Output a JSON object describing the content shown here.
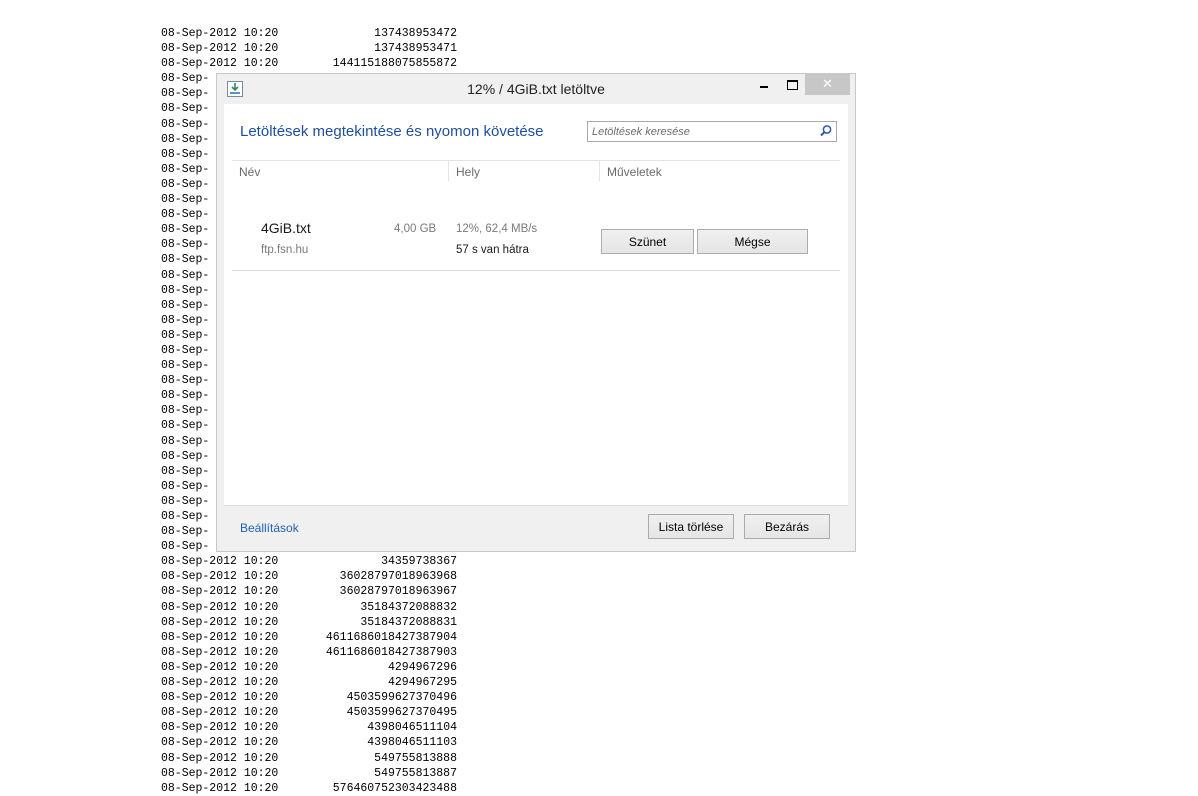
{
  "listing": {
    "rows": [
      {
        "date": "08-Sep-2012 10:20",
        "size": "137438953472"
      },
      {
        "date": "08-Sep-2012 10:20",
        "size": "137438953471"
      },
      {
        "date": "08-Sep-2012 10:20",
        "size": "144115188075855872"
      },
      {
        "date": "08-Sep-",
        "size": ""
      },
      {
        "date": "08-Sep-",
        "size": ""
      },
      {
        "date": "08-Sep-",
        "size": ""
      },
      {
        "date": "08-Sep-",
        "size": ""
      },
      {
        "date": "08-Sep-",
        "size": ""
      },
      {
        "date": "08-Sep-",
        "size": ""
      },
      {
        "date": "08-Sep-",
        "size": ""
      },
      {
        "date": "08-Sep-",
        "size": ""
      },
      {
        "date": "08-Sep-",
        "size": ""
      },
      {
        "date": "08-Sep-",
        "size": ""
      },
      {
        "date": "08-Sep-",
        "size": ""
      },
      {
        "date": "08-Sep-",
        "size": ""
      },
      {
        "date": "08-Sep-",
        "size": ""
      },
      {
        "date": "08-Sep-",
        "size": ""
      },
      {
        "date": "08-Sep-",
        "size": ""
      },
      {
        "date": "08-Sep-",
        "size": ""
      },
      {
        "date": "08-Sep-",
        "size": ""
      },
      {
        "date": "08-Sep-",
        "size": ""
      },
      {
        "date": "08-Sep-",
        "size": ""
      },
      {
        "date": "08-Sep-",
        "size": ""
      },
      {
        "date": "08-Sep-",
        "size": ""
      },
      {
        "date": "08-Sep-",
        "size": ""
      },
      {
        "date": "08-Sep-",
        "size": ""
      },
      {
        "date": "08-Sep-",
        "size": ""
      },
      {
        "date": "08-Sep-",
        "size": ""
      },
      {
        "date": "08-Sep-",
        "size": ""
      },
      {
        "date": "08-Sep-",
        "size": ""
      },
      {
        "date": "08-Sep-",
        "size": ""
      },
      {
        "date": "08-Sep-",
        "size": ""
      },
      {
        "date": "08-Sep-",
        "size": ""
      },
      {
        "date": "08-Sep-",
        "size": ""
      },
      {
        "date": "08-Sep-",
        "size": ""
      },
      {
        "date": "08-Sep-2012 10:20",
        "size": "34359738367"
      },
      {
        "date": "08-Sep-2012 10:20",
        "size": "36028797018963968"
      },
      {
        "date": "08-Sep-2012 10:20",
        "size": "36028797018963967"
      },
      {
        "date": "08-Sep-2012 10:20",
        "size": "35184372088832"
      },
      {
        "date": "08-Sep-2012 10:20",
        "size": "35184372088831"
      },
      {
        "date": "08-Sep-2012 10:20",
        "size": "4611686018427387904"
      },
      {
        "date": "08-Sep-2012 10:20",
        "size": "4611686018427387903"
      },
      {
        "date": "08-Sep-2012 10:20",
        "size": "4294967296"
      },
      {
        "date": "08-Sep-2012 10:20",
        "size": "4294967295"
      },
      {
        "date": "08-Sep-2012 10:20",
        "size": "4503599627370496"
      },
      {
        "date": "08-Sep-2012 10:20",
        "size": "4503599627370495"
      },
      {
        "date": "08-Sep-2012 10:20",
        "size": "4398046511104"
      },
      {
        "date": "08-Sep-2012 10:20",
        "size": "4398046511103"
      },
      {
        "date": "08-Sep-2012 10:20",
        "size": "549755813888"
      },
      {
        "date": "08-Sep-2012 10:20",
        "size": "549755813887"
      },
      {
        "date": "08-Sep-2012 10:20",
        "size": "576460752303423488"
      }
    ]
  },
  "dialog": {
    "title": "12% / 4GiB.txt letöltve",
    "close_glyph": "✕",
    "heading": "Letöltések megtekintése és nyomon követése",
    "search_placeholder": "Letöltések keresése",
    "columns": {
      "name": "Név",
      "location": "Hely",
      "actions": "Műveletek"
    },
    "download": {
      "file_name": "4GiB.txt",
      "host": "ftp.fsn.hu",
      "size": "4,00 GB",
      "progress": "12%, 62,4 MB/s",
      "remaining": "57 s van hátra",
      "pause_label": "Szünet",
      "cancel_label": "Mégse"
    },
    "footer": {
      "settings_label": "Beállítások",
      "clear_label": "Lista törlése",
      "close_label": "Bezárás"
    }
  },
  "colors": {
    "accent": "#1f4e9a",
    "link": "#1f5fb4"
  }
}
